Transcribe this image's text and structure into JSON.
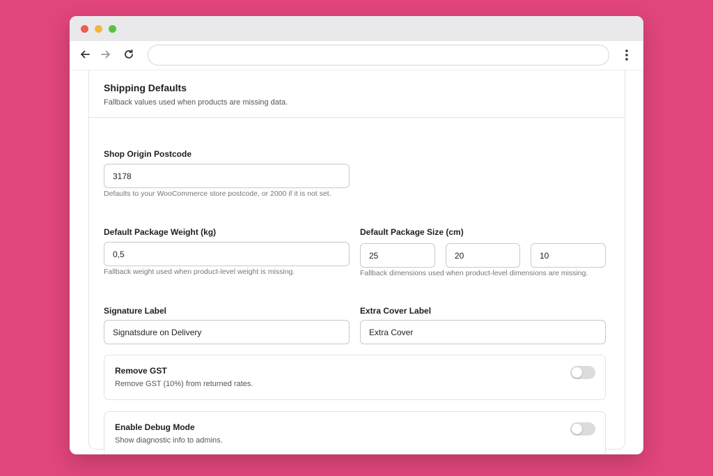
{
  "browser": {
    "address_value": "",
    "icons": [
      "back-arrow-icon",
      "forward-arrow-icon",
      "reload-icon",
      "more-vertical-icon"
    ]
  },
  "section": {
    "title": "Shipping Defaults",
    "description": "Fallback values used when products are missing data."
  },
  "origin_postcode": {
    "label": "Shop Origin Postcode",
    "value": "3178",
    "help": "Defaults to your WooCommerce store postcode, or 2000 if it is not set."
  },
  "package_weight": {
    "label": "Default Package Weight (kg)",
    "value": "0,5",
    "help": "Fallback weight used when product-level weight is missing."
  },
  "package_size": {
    "label": "Default Package Size (cm)",
    "length": "25",
    "width": "20",
    "height": "10",
    "help": "Fallback dimensions used when product-level dimensions are missing."
  },
  "signature_label": {
    "label": "Signature Label",
    "value": "Signatsdure on Delivery"
  },
  "extra_cover_label": {
    "label": "Extra Cover Label",
    "value": "Extra Cover"
  },
  "remove_gst": {
    "title": "Remove GST",
    "description": "Remove GST (10%) from returned rates.",
    "enabled": false
  },
  "debug_mode": {
    "title": "Enable Debug Mode",
    "description": "Show diagnostic info to admins.",
    "enabled": false
  },
  "colors": {
    "background": "#e0457b",
    "toggle_off": "#dcdcdc"
  }
}
